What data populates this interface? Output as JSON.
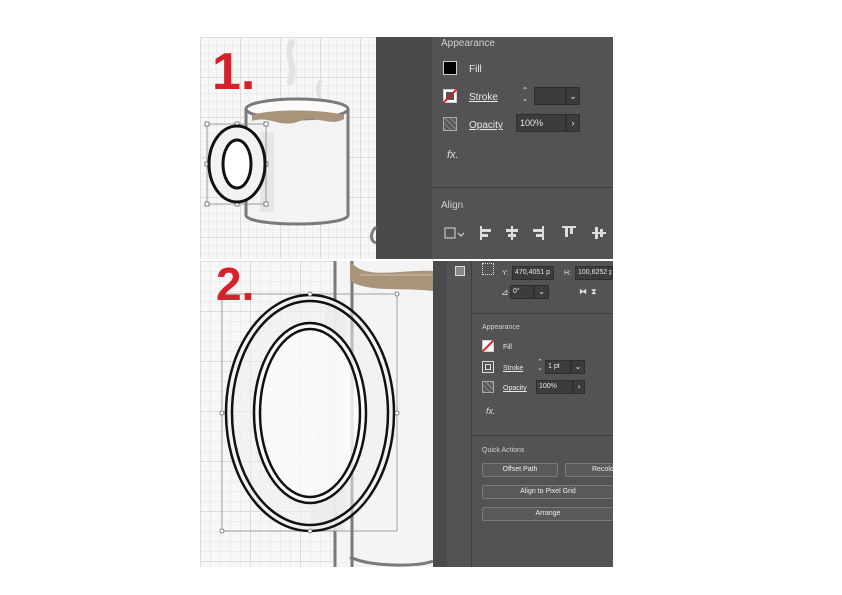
{
  "steps": {
    "step1": "1.",
    "step2": "2."
  },
  "panel1": {
    "appearance_title": "Appearance",
    "fill_label": "Fill",
    "stroke_label": "Stroke",
    "opacity_label": "Opacity",
    "opacity_value": "100%",
    "fx_label": "fx.",
    "align_title": "Align"
  },
  "panel2": {
    "y_label": "Y:",
    "y_value": "470,4051 p",
    "h_label": "H:",
    "h_value": "100,6252 p",
    "angle_value": "0°",
    "appearance_title": "Appearance",
    "fill_label": "Fill",
    "stroke_label": "Stroke",
    "stroke_weight": "1 pt",
    "opacity_label": "Opacity",
    "opacity_value": "100%",
    "fx_label": "fx.",
    "quick_actions_title": "Quick Actions",
    "offset_path": "Offset Path",
    "recolor": "Recolo",
    "align_pixel_grid": "Align to Pixel Grid",
    "arrange": "Arrange"
  },
  "colors": {
    "step_red": "#d6202a",
    "panel_bg": "#535353",
    "panel_dark": "#3c3c3c",
    "coffee": "#a89478"
  },
  "icons": [
    "mug-illustration",
    "ring-handle",
    "bounding-box",
    "chevron-down-icon",
    "chevron-right-icon",
    "stepper-icon",
    "fx-icon",
    "align-icon",
    "swatch-icon"
  ]
}
